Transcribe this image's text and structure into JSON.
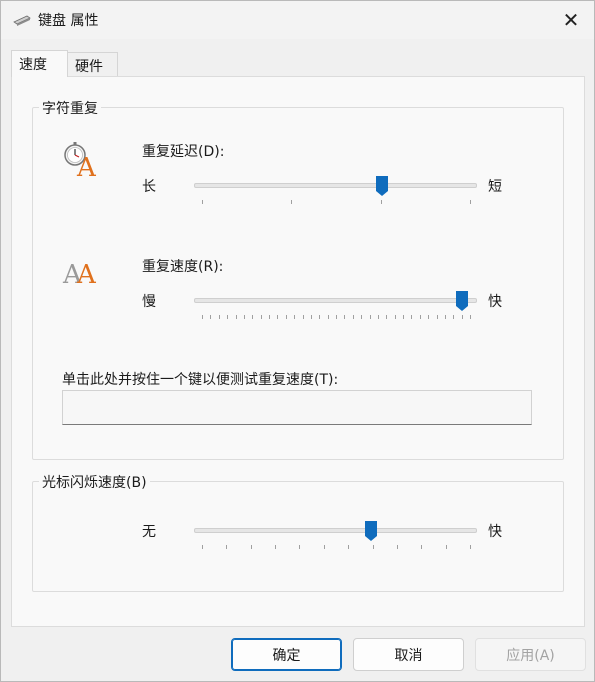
{
  "window": {
    "title": "键盘 属性",
    "close_glyph": "✕"
  },
  "tabs": [
    {
      "label": "速度",
      "active": true
    },
    {
      "label": "硬件",
      "active": false
    }
  ],
  "repeat_group": {
    "title": "字符重复",
    "delay": {
      "label": "重复延迟(D):",
      "min_label": "长",
      "max_label": "短",
      "position": 0.67,
      "tick_count": 4
    },
    "rate": {
      "label": "重复速度(R):",
      "min_label": "慢",
      "max_label": "快",
      "position": 0.97,
      "tick_count": 33
    },
    "test_label": "单击此处并按住一个键以便测试重复速度(T):",
    "test_value": ""
  },
  "cursor_group": {
    "title": "光标闪烁速度(B)",
    "blink": {
      "min_label": "无",
      "max_label": "快",
      "position": 0.63,
      "tick_count": 12
    }
  },
  "buttons": {
    "ok": "确定",
    "cancel": "取消",
    "apply": "应用(A)"
  },
  "colors": {
    "accent": "#0f6cbd",
    "icon_orange": "#e0711d"
  }
}
